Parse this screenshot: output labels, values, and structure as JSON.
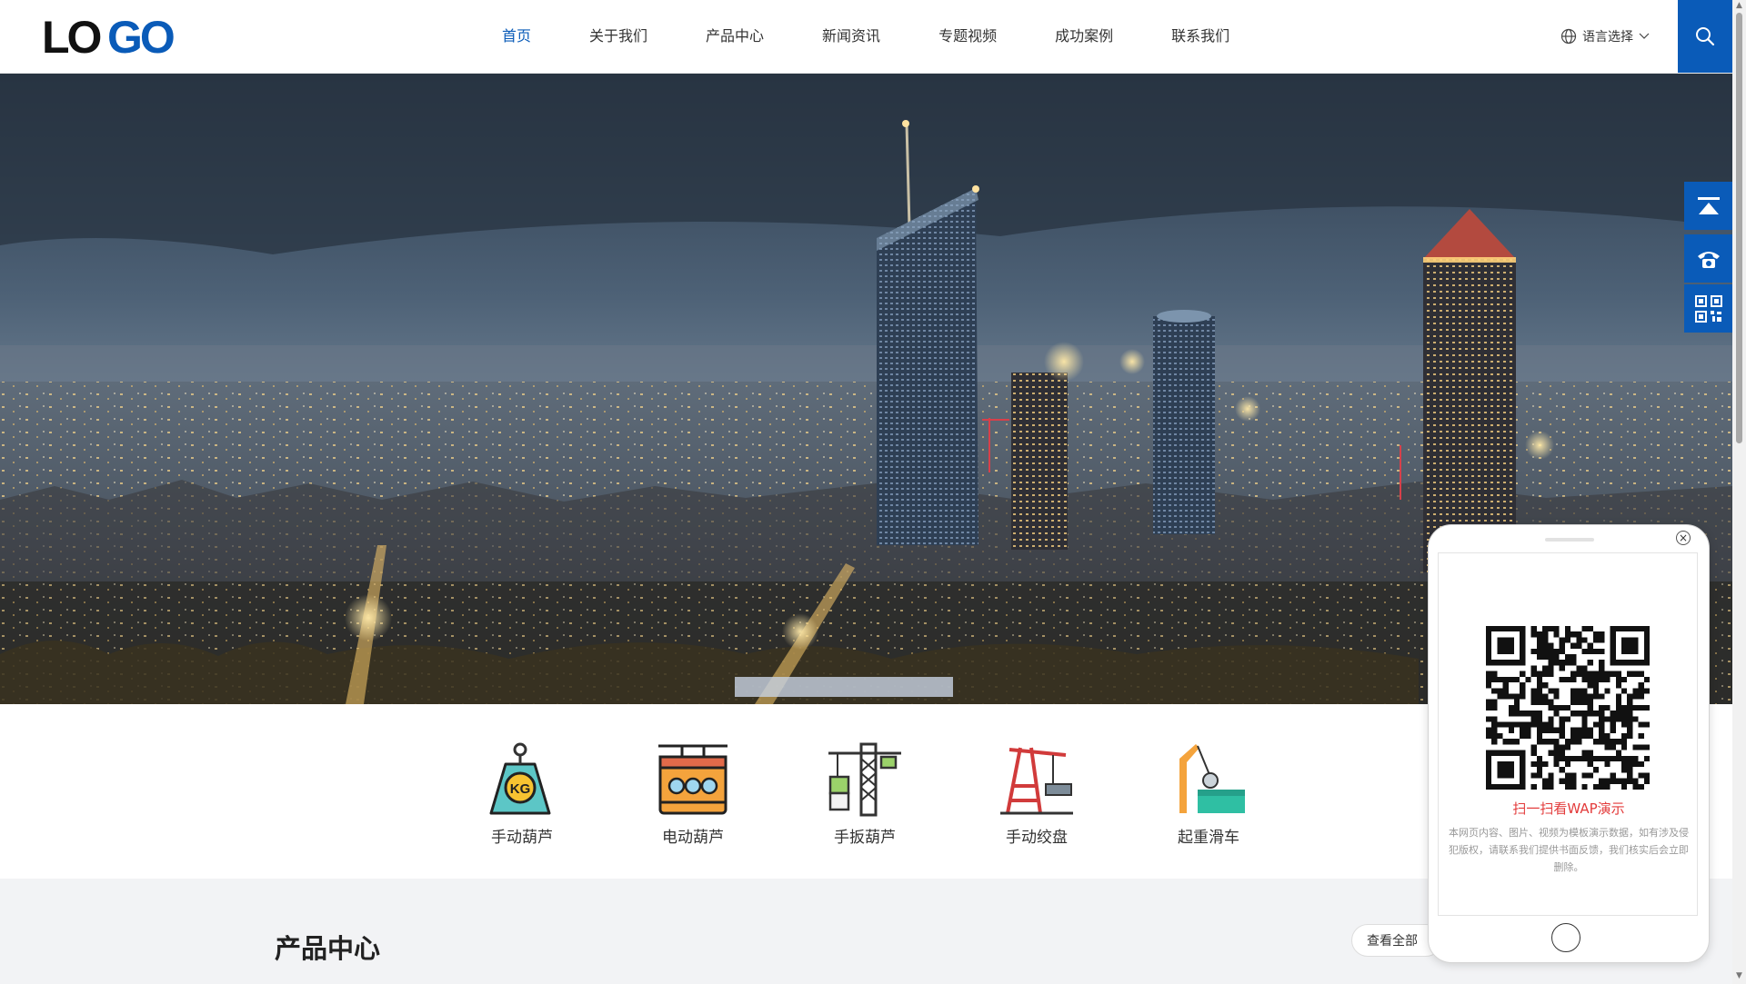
{
  "header": {
    "logo_text": "LOGO",
    "nav": [
      {
        "label": "首页",
        "active": true
      },
      {
        "label": "关于我们"
      },
      {
        "label": "产品中心"
      },
      {
        "label": "新闻资讯"
      },
      {
        "label": "专题视频"
      },
      {
        "label": "成功案例"
      },
      {
        "label": "联系我们"
      }
    ],
    "language_label": "语言选择",
    "accent_color": "#0a5bb8"
  },
  "categories": [
    {
      "label": "手动葫芦",
      "icon": "kg-weight-icon"
    },
    {
      "label": "电动葫芦",
      "icon": "cable-car-icon"
    },
    {
      "label": "手扳葫芦",
      "icon": "tower-crane-icon"
    },
    {
      "label": "手动绞盘",
      "icon": "harbor-crane-icon"
    },
    {
      "label": "起重滑车",
      "icon": "crane-hook-icon"
    }
  ],
  "section": {
    "title": "产品中心",
    "view_all_label": "查看全部"
  },
  "side_tools": [
    "back-to-top-icon",
    "phone-icon",
    "qr-code-icon"
  ],
  "qr_popup": {
    "scan_text": "扫一扫看WAP演示",
    "notice": "本网页内容、图片、视频为模板演示数据，如有涉及侵犯版权，请联系我们提供书面反馈，我们核实后会立即删除。",
    "close_symbol": "×"
  }
}
